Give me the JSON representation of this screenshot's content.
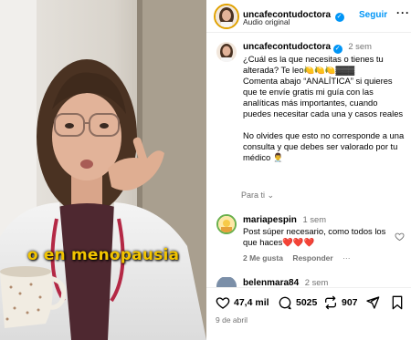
{
  "video": {
    "caption": "o en menopausia"
  },
  "header": {
    "username": "uncafecontudoctora",
    "audio": "Audio original",
    "follow_label": "Seguir",
    "more_label": "···"
  },
  "post": {
    "username": "uncafecontudoctora",
    "time": "2 sem",
    "text": "¿Cuál es la que necesitas o tienes tu alterada? Te leo🍋🍋🍋▓▓▓\nComenta abajo “ANALÍTICA” si quieres que te envíe gratis mi guía con las analíticas más importantes, cuando puedes necesitar cada una y casos reales\n\nNo olvides que esto no corresponde a una consulta y que debes ser valorado por tu médico 👨‍⚕️",
    "translate_label": "Para ti"
  },
  "reply": {
    "username": "mariapespin",
    "time": "1 sem",
    "text": "Post súper necesario, como todos los que haces❤️❤️❤️",
    "likes": "2 Me gusta",
    "reply_label": "Responder",
    "more_label": "···"
  },
  "next_comment": {
    "username": "belenmara84",
    "time": "2 sem"
  },
  "actions": {
    "likes": "47,4 mil",
    "comments": "5025",
    "reposts": "907",
    "date": "9 de abril"
  }
}
